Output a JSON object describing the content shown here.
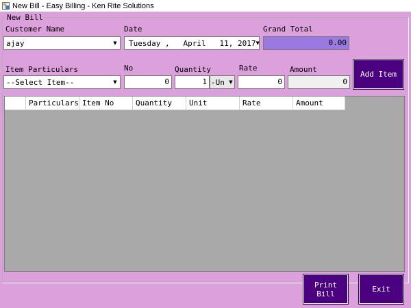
{
  "window": {
    "title": "New Bill - Easy Billing - Ken Rite Solutions"
  },
  "group": {
    "title": "New Bill"
  },
  "customer": {
    "label": "Customer Name",
    "value": "ajay"
  },
  "date": {
    "label": "Date",
    "day": "Tuesday",
    "month": "April",
    "dom": "11",
    "year": "2017"
  },
  "grand_total": {
    "label": "Grand Total",
    "value": "0.00"
  },
  "item": {
    "particulars_label": "Item Particulars",
    "particulars_value": "--Select Item--",
    "no_label": "No",
    "no_value": "0",
    "quantity_label": "Quantity",
    "quantity_value": "1",
    "unit_value": "-Un",
    "rate_label": "Rate",
    "rate_value": "0",
    "amount_label": "Amount",
    "amount_value": "0"
  },
  "buttons": {
    "add_item": "Add Item",
    "print_bill_line1": "Print",
    "print_bill_line2": "Bill",
    "exit": "Exit"
  },
  "grid": {
    "columns": [
      "Particulars",
      "Item No",
      "Quantity",
      "Unit",
      "Rate",
      "Amount"
    ]
  },
  "colors": {
    "form_bg": "#dca0dc",
    "button_bg": "#4b0082",
    "grand_total_bg": "#9a7ae0",
    "grid_bg": "#a9a9a9"
  }
}
